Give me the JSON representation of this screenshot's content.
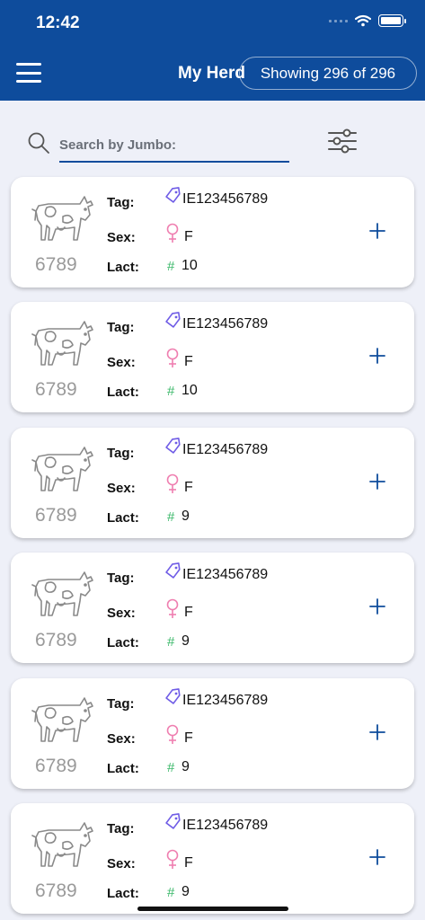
{
  "status_bar": {
    "time": "12:42"
  },
  "header": {
    "title": "My Herd",
    "count_label": "Showing 296 of 296"
  },
  "search": {
    "placeholder": "Search by Jumbo:"
  },
  "labels": {
    "tag": "Tag:",
    "sex": "Sex:",
    "lact": "Lact:",
    "hash": "#"
  },
  "colors": {
    "header_bg": "#0e4c9c",
    "tag_icon": "#6f5ce6",
    "female_icon": "#ef7fb0",
    "hash": "#3bb86a",
    "add_icon": "#0e4c9c"
  },
  "icons": {
    "menu": "hamburger-icon",
    "search": "search-icon",
    "filter": "sliders-icon",
    "cow": "cow-icon",
    "tag": "tag-icon",
    "sex": "female-icon",
    "add": "plus-icon"
  },
  "animals": [
    {
      "jumbo": "6789",
      "tag": "IE123456789",
      "sex": "F",
      "lact": "10"
    },
    {
      "jumbo": "6789",
      "tag": "IE123456789",
      "sex": "F",
      "lact": "10"
    },
    {
      "jumbo": "6789",
      "tag": "IE123456789",
      "sex": "F",
      "lact": "9"
    },
    {
      "jumbo": "6789",
      "tag": "IE123456789",
      "sex": "F",
      "lact": "9"
    },
    {
      "jumbo": "6789",
      "tag": "IE123456789",
      "sex": "F",
      "lact": "9"
    },
    {
      "jumbo": "6789",
      "tag": "IE123456789",
      "sex": "F",
      "lact": "9"
    }
  ]
}
